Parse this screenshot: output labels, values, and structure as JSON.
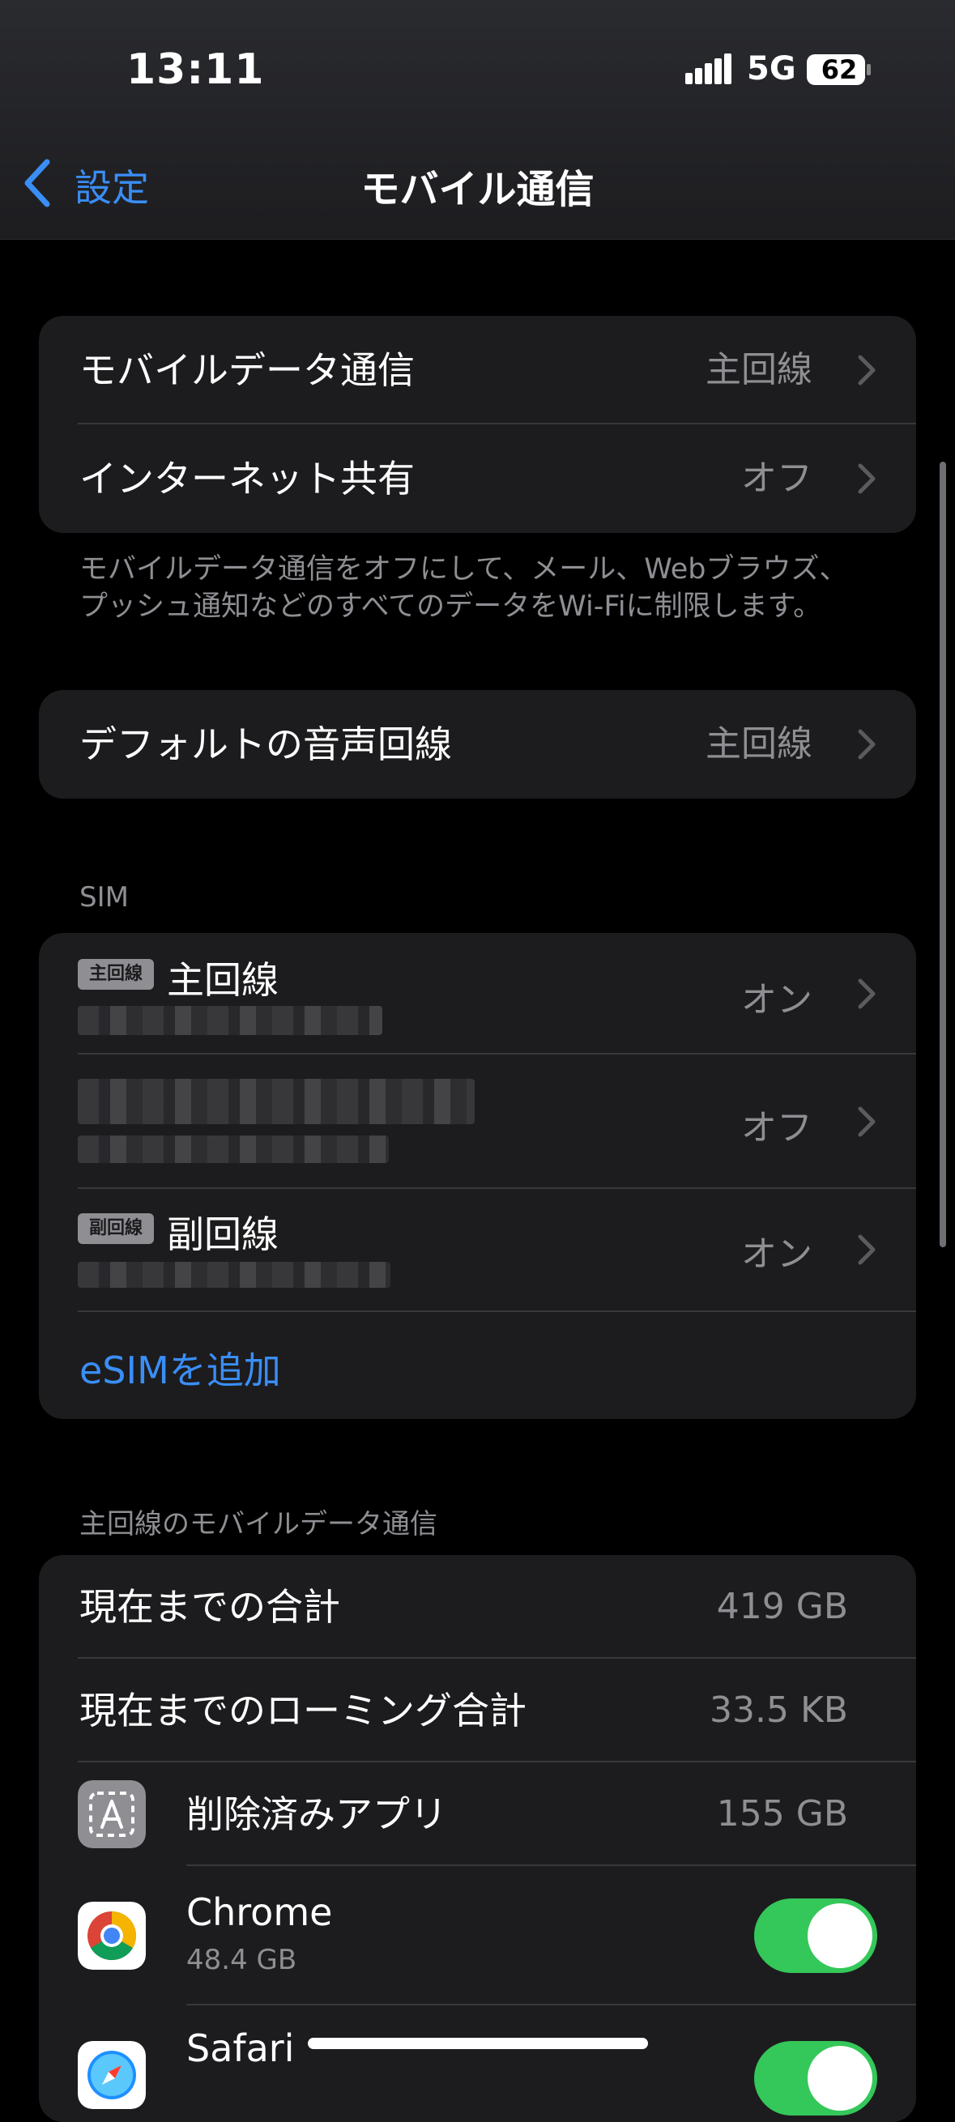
{
  "status_bar": {
    "time": "13:11",
    "network": "5G",
    "battery": "62"
  },
  "nav": {
    "back_label": "設定",
    "title": "モバイル通信"
  },
  "group1": {
    "rows": [
      {
        "label": "モバイルデータ通信",
        "value": "主回線"
      },
      {
        "label": "インターネット共有",
        "value": "オフ"
      }
    ],
    "footnote_line1": "モバイルデータ通信をオフにして、メール、Webブラウズ、",
    "footnote_line2": "プッシュ通知などのすべてのデータをWi-Fiに制限します。"
  },
  "group2": {
    "rows": [
      {
        "label": "デフォルトの音声回線",
        "value": "主回線"
      }
    ]
  },
  "sim_section": {
    "header": "SIM",
    "items": [
      {
        "badge": "主回線",
        "name": "主回線",
        "value": "オン"
      },
      {
        "badge": "",
        "name": "",
        "value": "オフ"
      },
      {
        "badge": "副回線",
        "name": "副回線",
        "value": "オン"
      }
    ],
    "add_esim": "eSIMを追加"
  },
  "usage_section": {
    "header": "主回線のモバイルデータ通信",
    "rows": [
      {
        "label": "現在までの合計",
        "value": "419 GB"
      },
      {
        "label": "現在までのローミング合計",
        "value": "33.5 KB"
      },
      {
        "label": "削除済みアプリ",
        "value": "155 GB"
      }
    ],
    "apps": [
      {
        "name": "Chrome",
        "size": "48.4 GB",
        "enabled": true
      },
      {
        "name": "Safari",
        "size": "",
        "enabled": true
      }
    ]
  },
  "colors": {
    "accent": "#3a8ef6",
    "toggle_on": "#34c759",
    "cell_bg": "#1c1c1e",
    "secondary_text": "#8e8e93"
  }
}
